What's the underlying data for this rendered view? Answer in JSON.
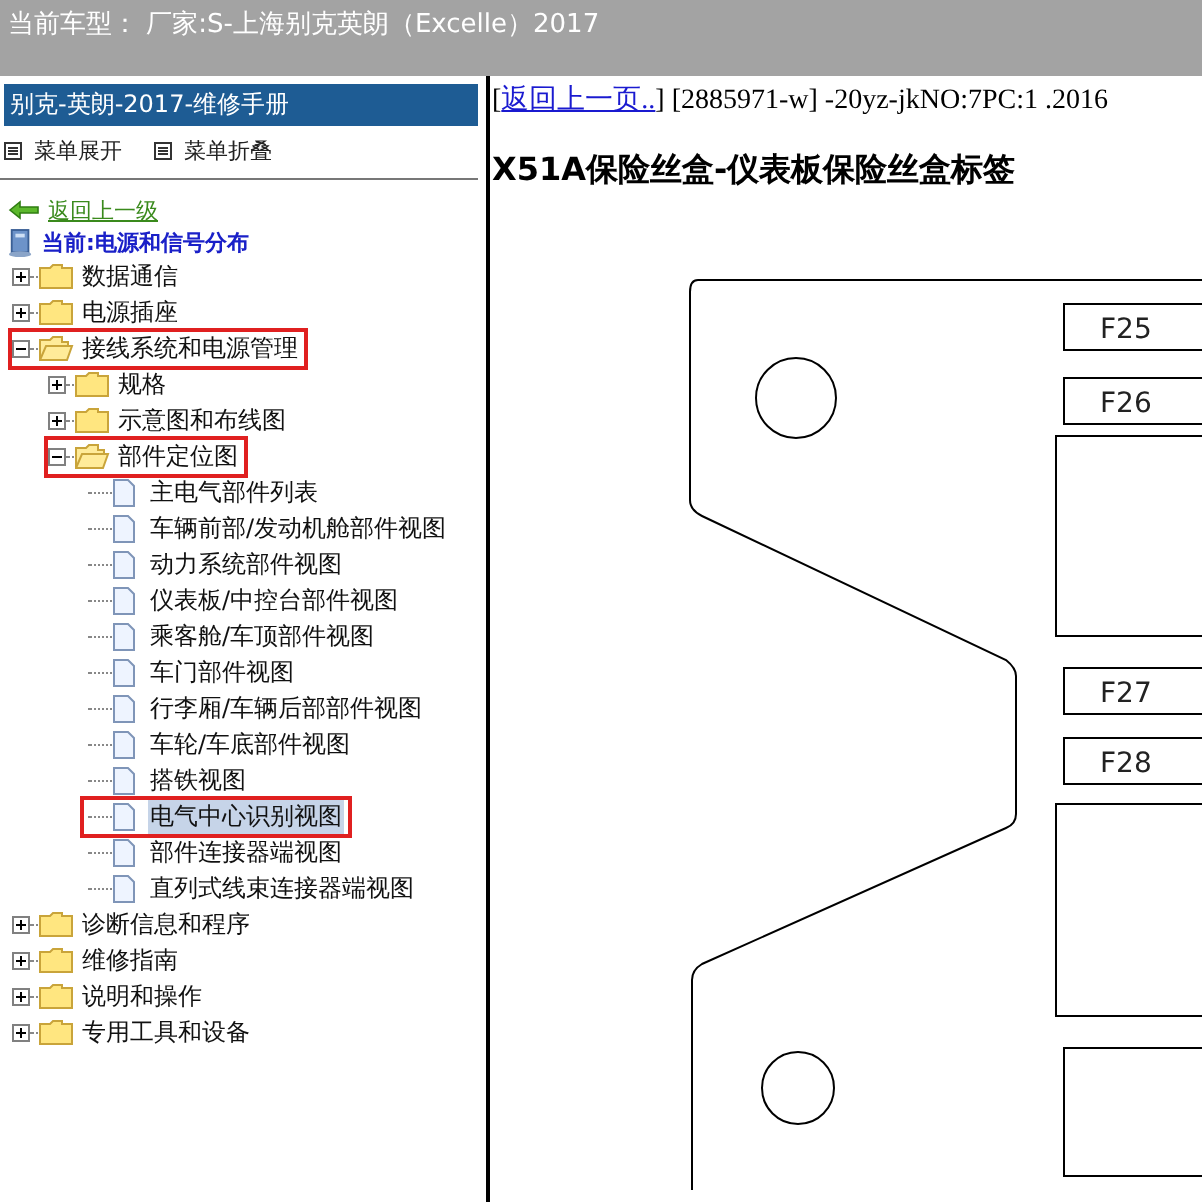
{
  "header": {
    "title": "当前车型： 厂家:S-上海别克英朗（Excelle）2017"
  },
  "sidebar": {
    "title": "别克-英朗-2017-维修手册",
    "menu_actions": [
      {
        "label": "菜单展开"
      },
      {
        "label": "菜单折叠"
      }
    ],
    "back_link": "返回上一级",
    "current": "当前:电源和信号分布",
    "tree": [
      {
        "label": "数据通信",
        "kind": "folder",
        "expanded": false,
        "marked": false,
        "selected": false
      },
      {
        "label": "电源插座",
        "kind": "folder",
        "expanded": false,
        "marked": false,
        "selected": false
      },
      {
        "label": "接线系统和电源管理",
        "kind": "folder",
        "expanded": true,
        "marked": true,
        "selected": false,
        "children": [
          {
            "label": "规格",
            "kind": "folder",
            "expanded": false,
            "marked": false,
            "selected": false
          },
          {
            "label": "示意图和布线图",
            "kind": "folder",
            "expanded": false,
            "marked": false,
            "selected": false
          },
          {
            "label": "部件定位图",
            "kind": "folder",
            "expanded": true,
            "marked": true,
            "selected": false,
            "children": [
              {
                "label": "主电气部件列表",
                "kind": "page",
                "marked": false,
                "selected": false
              },
              {
                "label": "车辆前部/发动机舱部件视图",
                "kind": "page",
                "marked": false,
                "selected": false
              },
              {
                "label": "动力系统部件视图",
                "kind": "page",
                "marked": false,
                "selected": false
              },
              {
                "label": "仪表板/中控台部件视图",
                "kind": "page",
                "marked": false,
                "selected": false
              },
              {
                "label": "乘客舱/车顶部件视图",
                "kind": "page",
                "marked": false,
                "selected": false
              },
              {
                "label": "车门部件视图",
                "kind": "page",
                "marked": false,
                "selected": false
              },
              {
                "label": "行李厢/车辆后部部件视图",
                "kind": "page",
                "marked": false,
                "selected": false
              },
              {
                "label": "车轮/车底部件视图",
                "kind": "page",
                "marked": false,
                "selected": false
              },
              {
                "label": "搭铁视图",
                "kind": "page",
                "marked": false,
                "selected": false
              },
              {
                "label": "电气中心识别视图",
                "kind": "page",
                "marked": true,
                "selected": true
              },
              {
                "label": "部件连接器端视图",
                "kind": "page",
                "marked": false,
                "selected": false
              },
              {
                "label": "直列式线束连接器端视图",
                "kind": "page",
                "marked": false,
                "selected": false
              }
            ]
          }
        ]
      },
      {
        "label": "诊断信息和程序",
        "kind": "folder",
        "expanded": false,
        "marked": false,
        "selected": false
      },
      {
        "label": "维修指南",
        "kind": "folder",
        "expanded": false,
        "marked": false,
        "selected": false
      },
      {
        "label": "说明和操作",
        "kind": "folder",
        "expanded": false,
        "marked": false,
        "selected": false
      },
      {
        "label": "专用工具和设备",
        "kind": "folder",
        "expanded": false,
        "marked": false,
        "selected": false
      }
    ]
  },
  "content": {
    "open_bracket": "[",
    "back_link": "返回上一页..",
    "reference": "] [2885971-w] -20yz-jkNO:7PC:1 .2016",
    "title": "X51A保险丝盒-仪表板保险丝盒标签",
    "fuse_labels": [
      "F25",
      "F26",
      "F27",
      "F28"
    ]
  }
}
